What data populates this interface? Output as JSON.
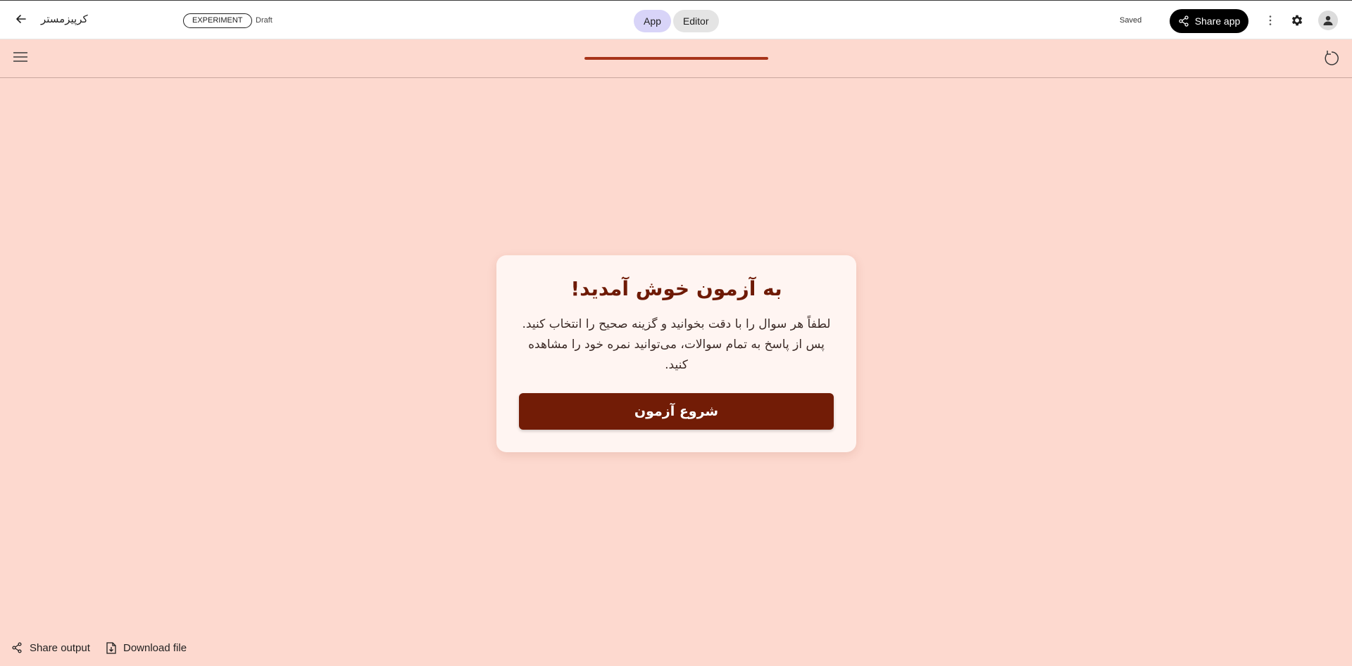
{
  "header": {
    "app_title": "کرپیزمستر",
    "badge": "EXPERIMENT",
    "status": "Draft",
    "tabs": [
      {
        "label": "App",
        "active": true
      },
      {
        "label": "Editor",
        "active": false
      }
    ],
    "saved_label": "Saved",
    "share_label": "Share app"
  },
  "subbar": {
    "progress_fraction": 1.0
  },
  "card": {
    "title": "به آزمون خوش آمدید!",
    "text": "لطفاً هر سوال را با دقت بخوانید و گزینه صحیح را انتخاب کنید. پس از پاسخ به تمام سوالات، می‌توانید نمره خود را مشاهده کنید.",
    "button_label": "شروع آزمون"
  },
  "footer": {
    "share_output_label": "Share output",
    "download_label": "Download file"
  },
  "colors": {
    "background": "#fdd9cf",
    "accent": "#721c06",
    "title": "#6e1a05",
    "progress": "#a8341a"
  },
  "icons": [
    "arrow-left-icon",
    "share-icon",
    "more-vert-icon",
    "gear-icon",
    "person-icon",
    "menu-icon",
    "refresh-icon",
    "file-download-icon"
  ]
}
